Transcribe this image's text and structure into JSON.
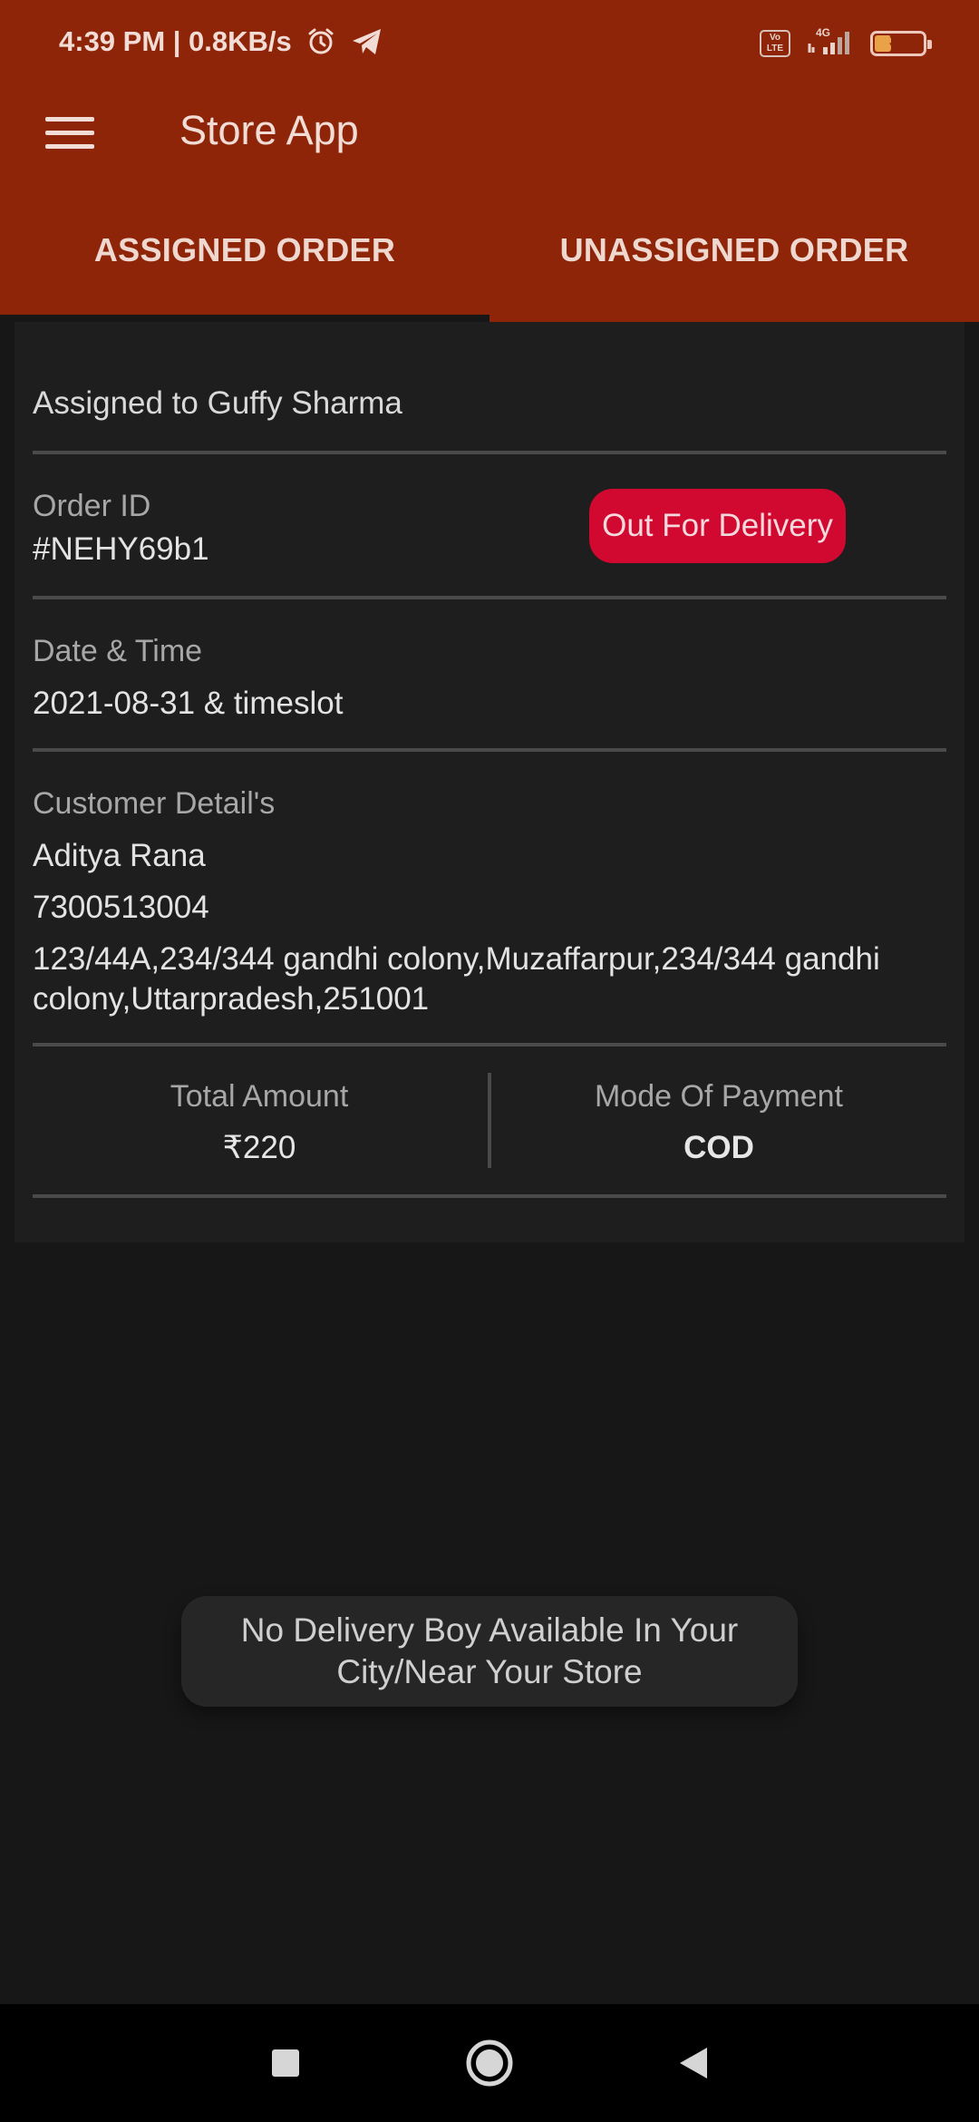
{
  "status_bar": {
    "time_speed": "4:39 PM | 0.8KB/s",
    "alarm_icon": "alarm-icon",
    "telegram_icon": "telegram-icon",
    "volte": "Vo LTE",
    "network_type": "4G",
    "battery_level": "32"
  },
  "toolbar": {
    "menu_icon": "hamburger-menu-icon",
    "title": "Store App"
  },
  "tabs": [
    {
      "label": "ASSIGNED ORDER",
      "selected": false
    },
    {
      "label": "UNASSIGNED ORDER",
      "selected": true
    }
  ],
  "order": {
    "assigned_to": "Assigned to Guffy Sharma",
    "order_id_label": "Order ID",
    "order_id": "#NEHY69b1",
    "status": "Out For Delivery",
    "date_time_label": "Date & Time",
    "date_time": "2021-08-31 & timeslot",
    "customer_label": "Customer Detail's",
    "customer_name": "Aditya Rana",
    "customer_phone": "7300513004",
    "customer_address": "123/44A,234/344 gandhi colony,Muzaffarpur,234/344 gandhi colony,Uttarpradesh,251001",
    "total_amount_label": "Total Amount",
    "total_amount": "₹220",
    "payment_mode_label": "Mode Of Payment",
    "payment_mode": "COD"
  },
  "toast": {
    "message": "No Delivery Boy Available In Your City/Near Your Store"
  },
  "navigation_bar": {
    "recents_icon": "recents-square-icon",
    "home_icon": "home-circle-icon",
    "back_icon": "back-triangle-icon"
  },
  "colors": {
    "primary": "#8f2508",
    "background": "#171717",
    "card": "#1e1e1e",
    "status_badge": "#d1082f",
    "text_primary": "#e3e3e3",
    "text_secondary": "#a7a7a7"
  }
}
